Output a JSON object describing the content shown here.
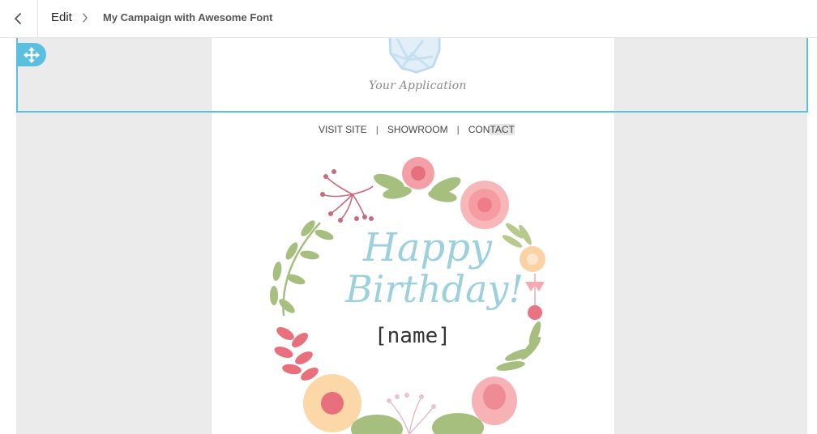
{
  "header": {
    "back_icon": "chevron-left-icon",
    "breadcrumb": {
      "edit_label": "Edit",
      "separator_icon": "chevron-right-icon",
      "campaign_title": "My Campaign with Awesome Font"
    }
  },
  "editor": {
    "move_handle_icon": "move-arrows-icon",
    "selection_color": "#5bbfe0"
  },
  "email": {
    "logo": {
      "icon": "hexagon-logo-icon",
      "text": "Your Application"
    },
    "nav": {
      "visit_site": "VISIT SITE",
      "separator": "|",
      "showroom": "SHOWROOM",
      "contact_prefix": "CON",
      "contact_highlight": "TACT"
    },
    "hero": {
      "line1": "Happy",
      "line2": "Birthday!",
      "name_placeholder": "[name]",
      "decoration": "floral-wreath-illustration"
    }
  }
}
